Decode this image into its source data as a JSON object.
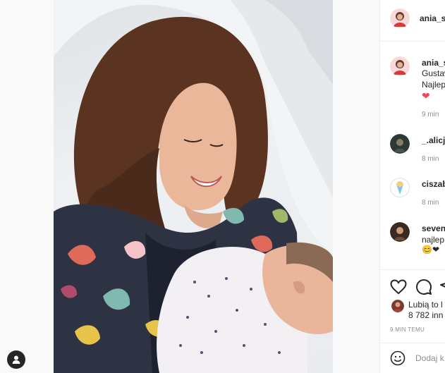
{
  "post": {
    "author": "ania_s",
    "photo_description_icon": "photo-of-mother-and-newborn"
  },
  "comments": [
    {
      "user": "ania_s",
      "lines": [
        "Gustaw",
        "Najlep"
      ],
      "emoji": "❤",
      "time": "9 min"
    },
    {
      "user": "_.alicja",
      "time": "8 min"
    },
    {
      "user": "ciszab",
      "time": "8 min"
    },
    {
      "user": "seven_",
      "lines": [
        "najlep"
      ],
      "emoji": "😊❤",
      "time": ""
    }
  ],
  "actions": {
    "likes_label": "Lubią to l",
    "likes_count": "8 782 inn",
    "timestamp": "9 MIN TEMU"
  },
  "composer": {
    "placeholder": "Dodaj k"
  },
  "colors": {
    "heart": "#ed4956",
    "muted": "#8e8e8e",
    "border": "#efefef"
  }
}
